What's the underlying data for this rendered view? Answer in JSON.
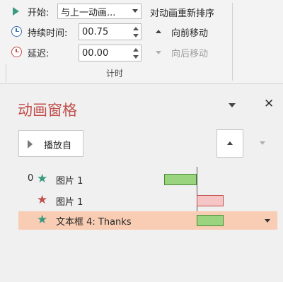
{
  "ribbon": {
    "start_label": "开始:",
    "start_value": "与上一动画...",
    "duration_label": "持续时间:",
    "duration_value": "00.75",
    "delay_label": "延迟:",
    "delay_value": "00.00",
    "reorder_title": "对动画重新排序",
    "move_earlier": "向前移动",
    "move_later": "向后移动",
    "group_label": "计时"
  },
  "pane": {
    "title": "动画窗格",
    "close_symbol": "✕",
    "play_label": "播放自",
    "items": [
      {
        "index": "0",
        "star_color": "#3a9a80",
        "label": "图片 1",
        "bar_color": "#9bd47e",
        "bar_border": "#4a8a3a"
      },
      {
        "index": "",
        "star_color": "#c0504d",
        "label": "图片 1",
        "bar_color": "#f6c6c6",
        "bar_border": "#c0504d"
      },
      {
        "index": "",
        "star_color": "#3a9a80",
        "label": "文本框 4: Thanks",
        "bar_color": "#9bd47e",
        "bar_border": "#4a8a3a"
      }
    ],
    "selected_row_color": "#f8cdb4"
  },
  "icons": [
    "play-icon",
    "clock-icon",
    "delay-clock-icon",
    "chevron-up-icon",
    "chevron-down-icon",
    "close-icon",
    "star-icon"
  ]
}
